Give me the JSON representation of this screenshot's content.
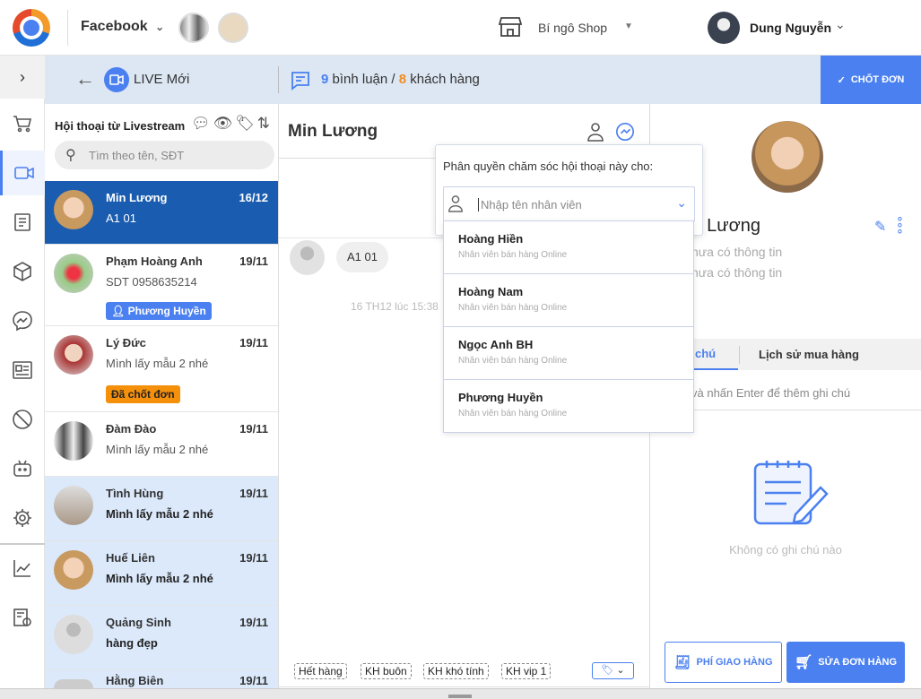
{
  "topbar": {
    "channel": "Facebook",
    "shop": "Bí ngô Shop",
    "user": "Dung Nguyễn"
  },
  "subheader": {
    "back": "←",
    "live_label": "LIVE Mới",
    "comments_count": "9",
    "comments_label": "bình luận /",
    "customers_count": "8",
    "customers_label": "khách hàng",
    "close_order": "CHỐT ĐƠN"
  },
  "list": {
    "title": "Hội thoại từ Livestream",
    "search_placeholder": "Tìm theo tên, SĐT",
    "items": [
      {
        "name": "Min Lương",
        "date": "16/12",
        "msg": "A1 01"
      },
      {
        "name": "Phạm Hoàng Anh",
        "date": "19/11",
        "msg": "SDT 0958635214",
        "badge": "Phương Huyền"
      },
      {
        "name": "Lý Đức",
        "date": "19/11",
        "msg": "Mình lấy mẫu 2 nhé",
        "badge": "Đã chốt đơn"
      },
      {
        "name": "Đàm Đào",
        "date": "19/11",
        "msg": "Mình lấy mẫu 2 nhé"
      },
      {
        "name": "Tình Hùng",
        "date": "19/11",
        "msg": "Mình lấy mẫu 2 nhé"
      },
      {
        "name": "Huế Liên",
        "date": "19/11",
        "msg": "Mình lấy mẫu 2 nhé"
      },
      {
        "name": "Quảng Sinh",
        "date": "19/11",
        "msg": "hàng đẹp"
      },
      {
        "name": "Hằng Biên",
        "date": "19/11",
        "msg": ""
      }
    ]
  },
  "chat": {
    "title": "Min Lương",
    "message": "A1 01",
    "timestamp": "16 TH12 lúc 15:38",
    "tags": [
      "Hết hàng",
      "KH buôn",
      "KH khó tính",
      "KH vip 1"
    ]
  },
  "assign": {
    "title": "Phân quyền chăm sóc hội thoại này cho:",
    "placeholder": "Nhập tên nhân viên",
    "options": [
      {
        "name": "Hoàng Hiền",
        "role": "Nhân viên bán hàng Online"
      },
      {
        "name": "Hoàng Nam",
        "role": "Nhân viên bán hàng Online"
      },
      {
        "name": "Ngọc Anh BH",
        "role": "Nhân viên bán hàng Online"
      },
      {
        "name": "Phương Huyền",
        "role": "Nhân viên bán hàng Online"
      }
    ]
  },
  "customer": {
    "name": ". Lương",
    "phone": "hưa có thông tin",
    "address": "hưa có thông tin",
    "tab_notes": "chú",
    "tab_history": "Lịch sử mua hàng",
    "note_placeholder": "và nhấn Enter để thêm ghi chú",
    "empty": "Không có ghi chú nào",
    "shipping_btn": "PHÍ GIAO HÀNG",
    "edit_order_btn": "SỬA ĐƠN HÀNG"
  },
  "colors": {
    "accent": "#4a80f0",
    "selected": "#1a5cb0",
    "unread": "#dbe9fb",
    "orange": "#f28c1e"
  }
}
